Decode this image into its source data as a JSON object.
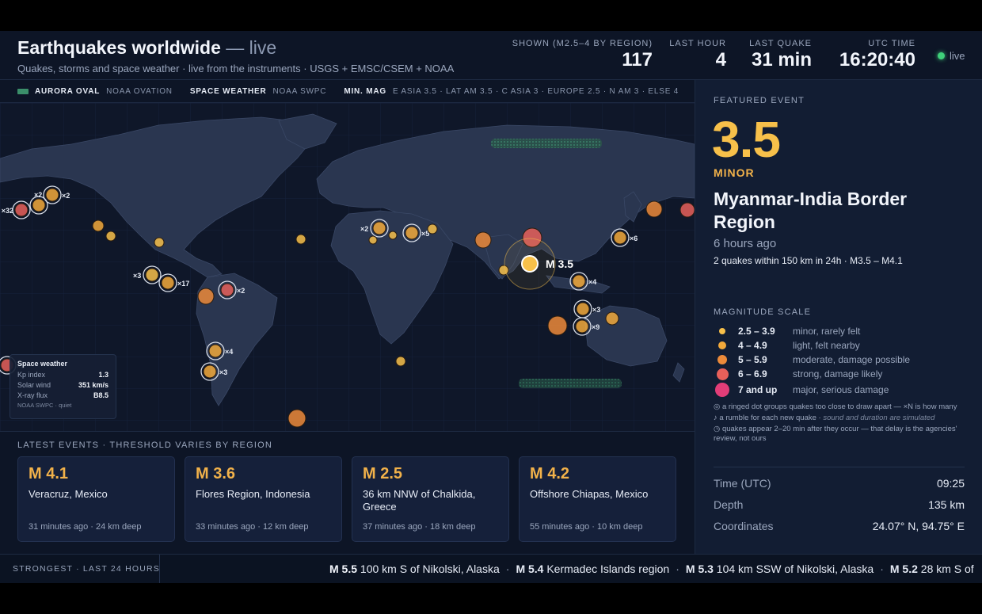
{
  "header": {
    "title": "Earthquakes worldwide",
    "title_suffix": "— live",
    "subtitle": "Quakes, storms and space weather · live from the instruments · USGS + EMSC/CSEM + NOAA",
    "stats": [
      {
        "label": "SHOWN (M2.5–4 BY REGION)",
        "value": "117"
      },
      {
        "label": "LAST HOUR",
        "value": "4"
      },
      {
        "label": "LAST QUAKE",
        "value": "31 min"
      },
      {
        "label": "UTC TIME",
        "value": "16:20:40"
      }
    ],
    "live_label": "live"
  },
  "legend": {
    "aurora_key": "AURORA OVAL",
    "aurora_src": "NOAA OVATION",
    "space_key": "SPACE WEATHER",
    "space_src": "NOAA SWPC",
    "minmag_key": "MIN. MAG",
    "minmag_val": "E ASIA 3.5 · LAT AM 3.5 · C ASIA 3 · EUROPE 2.5 · N AM 3 · ELSE 4"
  },
  "map": {
    "featured_label": "M 3.5",
    "cluster_labels": [
      "×32",
      "×2",
      "×2",
      "×3",
      "×17",
      "×2",
      "×4",
      "×3",
      "×3",
      "×2",
      "×5",
      "×4",
      "×3",
      "×9",
      "×6"
    ],
    "space_weather": {
      "title": "Space weather",
      "rows": [
        {
          "k": "Kp index",
          "v": "1.3"
        },
        {
          "k": "Solar wind",
          "v": "351 km/s"
        },
        {
          "k": "X-ray flux",
          "v": "B8.5"
        }
      ],
      "footer": "NOAA SWPC · quiet"
    }
  },
  "latest": {
    "heading": "LATEST EVENTS · THRESHOLD VARIES BY REGION",
    "events": [
      {
        "mag": "M 4.1",
        "place": "Veracruz, Mexico",
        "meta": "31 minutes ago · 24 km deep"
      },
      {
        "mag": "M 3.6",
        "place": "Flores Region, Indonesia",
        "meta": "33 minutes ago · 12 km deep"
      },
      {
        "mag": "M 2.5",
        "place": "36 km NNW of Chalkida, Greece",
        "meta": "37 minutes ago · 18 km deep"
      },
      {
        "mag": "M 4.2",
        "place": "Offshore Chiapas, Mexico",
        "meta": "55 minutes ago · 10 km deep"
      }
    ]
  },
  "featured": {
    "label": "FEATURED EVENT",
    "magnitude": "3.5",
    "class": "MINOR",
    "place": "Myanmar-India Border Region",
    "ago": "6 hours ago",
    "nearby": "2 quakes within 150 km in 24h · M3.5 – M4.1",
    "scale_label": "MAGNITUDE SCALE",
    "scale": [
      {
        "range": "2.5 – 3.9",
        "desc": "minor, rarely felt",
        "color": "#f7c04a"
      },
      {
        "range": "4 – 4.9",
        "desc": "light, felt nearby",
        "color": "#f2a93b"
      },
      {
        "range": "5 – 5.9",
        "desc": "moderate, damage possible",
        "color": "#ec8a3a"
      },
      {
        "range": "6 – 6.9",
        "desc": "strong, damage likely",
        "color": "#e8605a"
      },
      {
        "range": "7 and up",
        "desc": "major, serious damage",
        "color": "#e23d78"
      }
    ],
    "notes": {
      "ring": "a ringed dot groups quakes too close to draw apart — ×N is how many",
      "rumble": "a rumble for each new quake ·",
      "rumble_dim": "sound and duration are simulated",
      "delay": "quakes appear 2–20 min after they occur — that delay is the agencies' review, not ours"
    },
    "details": [
      {
        "k": "Time (UTC)",
        "v": "09:25"
      },
      {
        "k": "Depth",
        "v": "135 km"
      },
      {
        "k": "Coordinates",
        "v": "24.07° N, 94.75° E"
      }
    ]
  },
  "ticker": {
    "label": "STRONGEST · LAST 24 HOURS",
    "items": [
      {
        "mag": "M 5.5",
        "place": "100 km S of Nikolski, Alaska"
      },
      {
        "mag": "M 5.4",
        "place": "Kermadec Islands region"
      },
      {
        "mag": "M 5.3",
        "place": "104 km SSW of Nikolski, Alaska"
      },
      {
        "mag": "M 5.2",
        "place": "28 km S of"
      }
    ]
  },
  "colors": {
    "minor": "#f7c04a",
    "light": "#f2a93b",
    "moderate": "#ec8a3a",
    "strong": "#e8605a",
    "major": "#e23d78",
    "live": "#3fd07a",
    "aurora": "#3b8f6a"
  }
}
